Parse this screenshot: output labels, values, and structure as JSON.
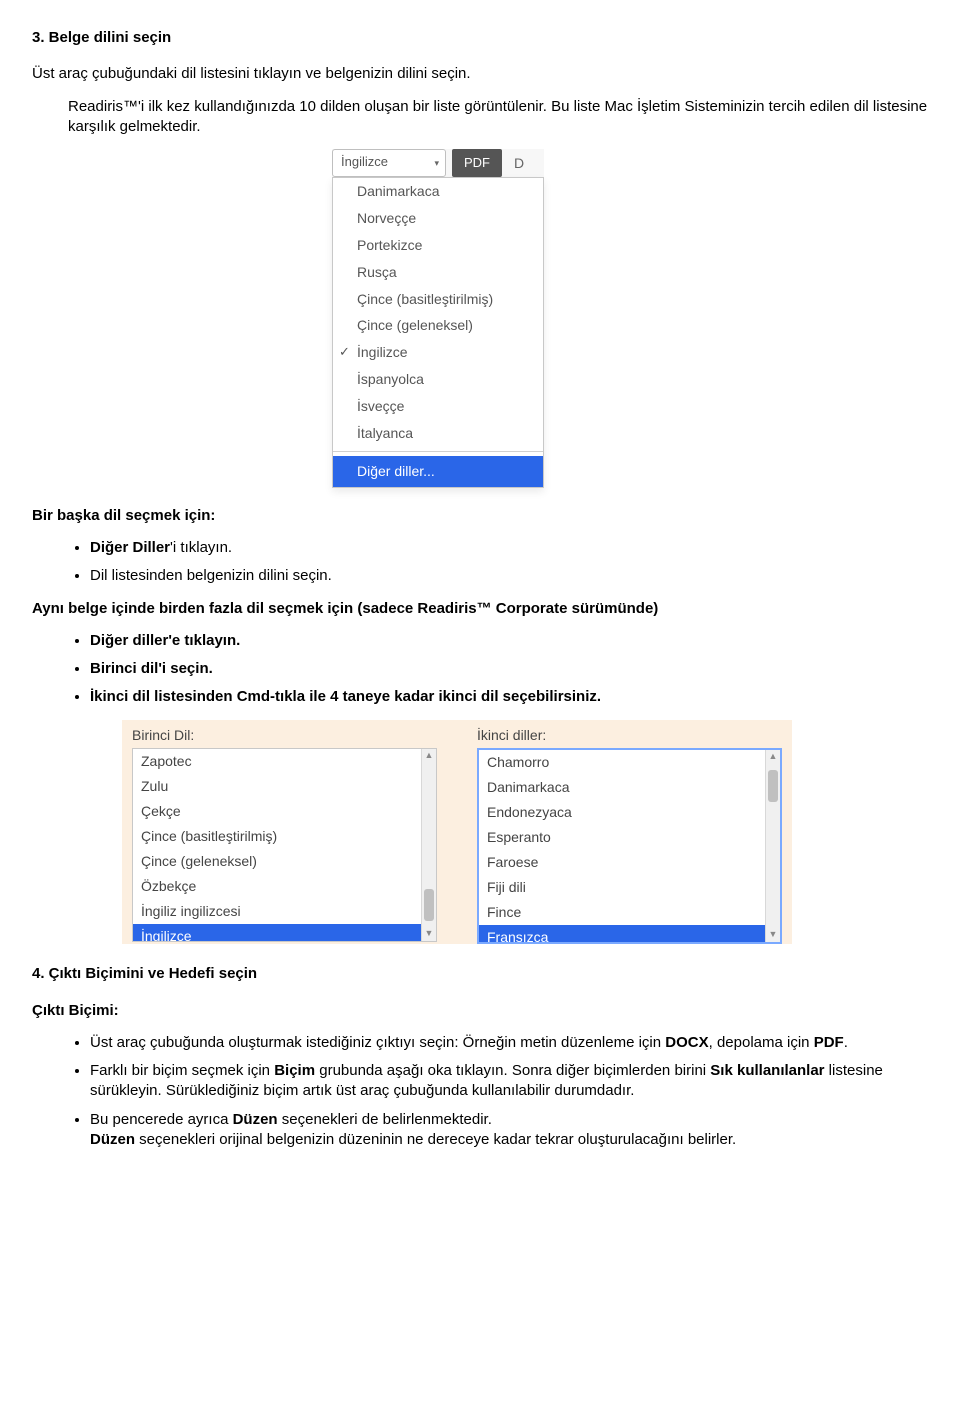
{
  "section3": {
    "title": "3. Belge dilini seçin",
    "p1": "Üst araç çubuğundaki dil listesini tıklayın ve belgenizin dilini seçin.",
    "p2a": "Readiris™'i ilk kez kullandığınızda 10 dilden oluşan bir liste görüntülenir. Bu liste Mac İşletim Sisteminizin tercih edilen dil listesine karşılık gelmektedir."
  },
  "toolbar": {
    "language": "İngilizce",
    "pdf_button": "PDF",
    "extra": "D"
  },
  "lang_menu": {
    "items": [
      "Danimarkaca",
      "Norveççe",
      "Portekizce",
      "Rusça",
      "Çince (basitleştirilmiş)",
      "Çince (geleneksel)",
      "İngilizce",
      "İspanyolca",
      "İsveççe",
      "İtalyanca"
    ],
    "checked_index": 6,
    "footer": "Diğer diller..."
  },
  "block_another": {
    "heading": "Bir başka dil seçmek için:",
    "b1a": "Diğer Diller",
    "b1b": "'i tıklayın.",
    "b2": "Dil listesinden belgenizin dilini seçin."
  },
  "block_multi": {
    "heading": "Aynı belge içinde birden fazla dil seçmek için (sadece Readiris™ Corporate sürümünde)",
    "b1a": "Diğer diller",
    "b1b": "'e tıklayın.",
    "b2a": "Birinci dil",
    "b2b": "'i seçin.",
    "b3a": "İkinci dil listesinden ",
    "b3b": "Cmd-tıkla",
    "b3c": " ile 4 taneye kadar ikinci dil seçebilirsiniz."
  },
  "dual": {
    "left_label": "Birinci Dil:",
    "right_label": "İkinci diller:",
    "left_items": [
      "Zapotec",
      "Zulu",
      "Çekçe",
      "Çince (basitleştirilmiş)",
      "Çince (geleneksel)",
      "Özbekçe",
      "İngiliz ingilizcesi",
      "İngilizce"
    ],
    "left_selected_index": 7,
    "right_items": [
      "Chamorro",
      "Danimarkaca",
      "Endonezyaca",
      "Esperanto",
      "Faroese",
      "Fiji dili",
      "Fince",
      "Fransızca"
    ],
    "right_selected_index": 7
  },
  "section4": {
    "title": "4. Çıktı Biçimini ve Hedefi seçin",
    "sub": "Çıktı Biçimi:",
    "b1a": "Üst araç çubuğunda oluşturmak istediğiniz çıktıyı seçin: Örneğin metin düzenleme için ",
    "b1b": "DOCX",
    "b1c": ", depolama için ",
    "b1d": "PDF",
    "b1e": ".",
    "b2a": "Farklı bir biçim seçmek için ",
    "b2b": "Biçim",
    "b2c": " grubunda aşağı oka tıklayın. Sonra diğer biçimlerden birini ",
    "b2d": "Sık kullanılanlar",
    "b2e": " listesine sürükleyin. Sürüklediğiniz biçim artık üst araç çubuğunda kullanılabilir durumdadır.",
    "b3a": "Bu pencerede ayrıca ",
    "b3b": "Düzen",
    "b3c": " seçenekleri de belirlenmektedir.",
    "b3d": "Düzen",
    "b3e": " seçenekleri orijinal belgenizin düzeninin ne dereceye kadar tekrar oluşturulacağını belirler."
  }
}
